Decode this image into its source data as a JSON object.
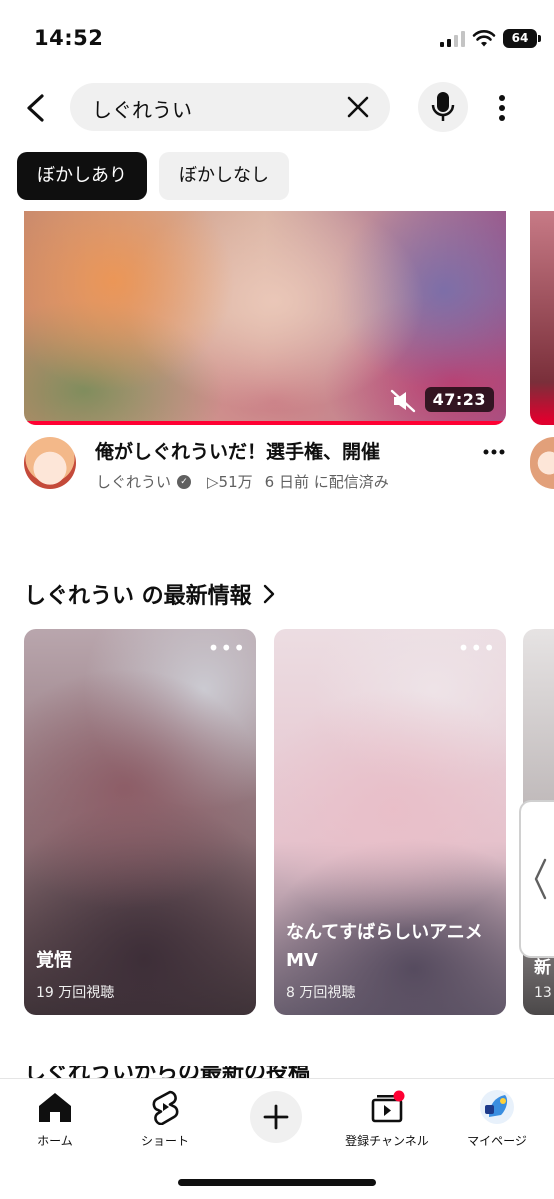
{
  "status_bar": {
    "time": "14:52",
    "battery": "64"
  },
  "search": {
    "query": "しぐれうい"
  },
  "chips": [
    {
      "label": "ぼかしあり",
      "active": true
    },
    {
      "label": "ぼかしなし",
      "active": false
    }
  ],
  "video": {
    "duration": "47:23",
    "title": "俺がしぐれういだ！選手権、開催",
    "channel": "しぐれうい",
    "views": "▷51万",
    "age": "6 日前 に配信済み"
  },
  "latest_section": {
    "title": "しぐれうい の最新情報",
    "shorts": [
      {
        "title": "覚悟",
        "views": "19 万回視聴"
      },
      {
        "title": "なんてすばらしいアニメ MV",
        "views": "8 万回視聴"
      },
      {
        "title": "新",
        "views": "13"
      }
    ]
  },
  "next_section": {
    "title": "しぐれういからの最新の投稿"
  },
  "bottom_nav": {
    "home": "ホーム",
    "shorts": "ショート",
    "subscriptions": "登録チャンネル",
    "you": "マイページ"
  },
  "colors": {
    "accent": "#ff0033",
    "chip_active": "#0f0f0f",
    "chip_inactive": "#f0f0f0"
  }
}
